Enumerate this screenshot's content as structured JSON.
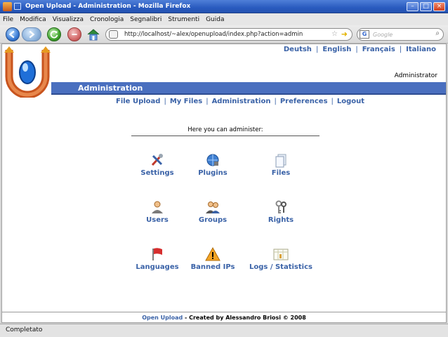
{
  "window": {
    "title": "Open Upload - Administration - Mozilla Firefox"
  },
  "menu": [
    "File",
    "Modifica",
    "Visualizza",
    "Cronologia",
    "Segnalibri",
    "Strumenti",
    "Guida"
  ],
  "toolbar": {
    "url": "http://localhost/~alex/openupload/index.php?action=admin",
    "search_engine": "G",
    "search_placeholder": "Google"
  },
  "page": {
    "languages": [
      "Deutsh",
      "English",
      "Français",
      "Italiano"
    ],
    "user_label": "Administrator",
    "section_title": "Administration",
    "nav": [
      "File Upload",
      "My Files",
      "Administration",
      "Preferences",
      "Logout"
    ],
    "intro": "Here you can administer:",
    "tiles": [
      {
        "label": "Settings",
        "icon": "tools-icon"
      },
      {
        "label": "Plugins",
        "icon": "plugin-globe-icon"
      },
      {
        "label": "Files",
        "icon": "files-icon"
      },
      {
        "label": "Users",
        "icon": "user-icon"
      },
      {
        "label": "Groups",
        "icon": "group-icon"
      },
      {
        "label": "Rights",
        "icon": "keys-icon"
      },
      {
        "label": "Languages",
        "icon": "flag-icon"
      },
      {
        "label": "Banned IPs",
        "icon": "warning-icon"
      },
      {
        "label": "Logs / Statistics",
        "icon": "statistics-icon"
      }
    ],
    "footer_brand": "Open Upload",
    "footer_text": " - Created by Alessandro Briosi © 2008"
  },
  "status": {
    "text": "Completato"
  },
  "colors": {
    "link": "#3a62a7",
    "header_bar": "#4a6fbf",
    "titlebar": "#2a5bbf"
  }
}
